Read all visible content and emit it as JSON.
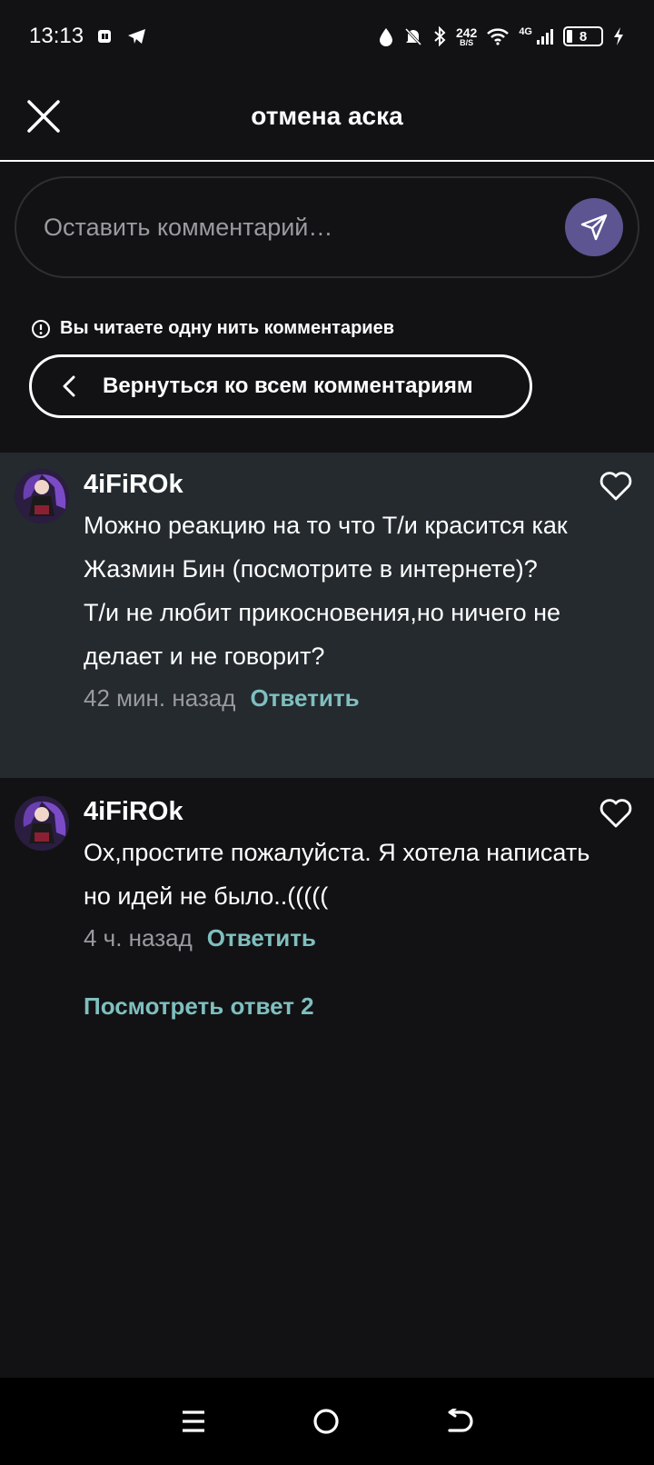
{
  "status_bar": {
    "time": "13:13",
    "speed_num": "242",
    "speed_unit": "B/S",
    "network": "4G",
    "battery": "8",
    "icons": [
      "app-icon",
      "telegram-icon",
      "drop-icon",
      "mute-icon",
      "bluetooth-icon",
      "wifi-icon",
      "signal-icon",
      "battery-icon",
      "charging-icon"
    ]
  },
  "header": {
    "title": "отмена аска"
  },
  "comment_input": {
    "placeholder": "Оставить комментарий…"
  },
  "thread": {
    "note": "Вы читаете одну нить комментариев",
    "back_label": "Вернуться ко всем комментариям"
  },
  "comments": [
    {
      "user": "4iFiROk",
      "text": "Можно реакцию на то что Т/и красится как Жазмин Бин (посмотрите в интернете)?\nТ/и не любит прикосновения,но ничего не делает и не говорит?",
      "time": "42 мин. назад",
      "reply_label": "Ответить"
    },
    {
      "user": "4iFiROk",
      "text": "Ох,простите пожалуйста. Я хотела написать но идей не было..(((((",
      "time": "4 ч. назад",
      "reply_label": "Ответить"
    }
  ],
  "view_replies": "Посмотреть ответ 2",
  "colors": {
    "accent": "#7fbfbf",
    "send_button": "#5c5592",
    "highlight_bg": "#242a2e",
    "background": "#121214"
  }
}
